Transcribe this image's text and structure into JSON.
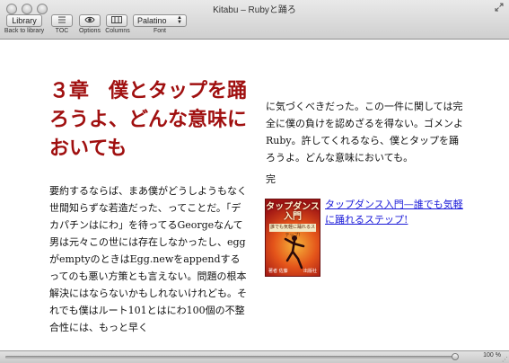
{
  "window": {
    "title": "Kitabu – Rubyと踊ろ"
  },
  "toolbar": {
    "library_button": "Library",
    "library_label": "Back to library",
    "toc_label": "TOC",
    "options_label": "Options",
    "columns_label": "Columns",
    "font_value": "Palatino",
    "font_label": "Font"
  },
  "chapter": {
    "title": "３章　僕とタップを踊ろうよ、どんな意味においても",
    "left_text": "要約するならば、まあ僕がどうしようもなく世間知らずな若造だった、ってことだ。「デカパチンはにわ」を待ってるGeorgeなんて男は元々この世には存在しなかったし、eggがemptyのときはEgg.newをappendするってのも悪い方策とも言えない。問題の根本解決にはならないかもしれないけれども。それでも僕はルート101とはにわ100個の不整合性には、もっと早く",
    "right_text": "に気づくべきだった。この一件に関しては完全に僕の負けを認めざるを得ない。ゴメンよRuby。許してくれるなら、僕とタップを踊ろうよ。どんな意味においても。",
    "end_mark": "完"
  },
  "book": {
    "cover_title": "タップダンス入門",
    "cover_subtitle": "誰でも気軽に踊れるステップ!",
    "cover_author": "著者 佐藤",
    "cover_publisher": "出版社",
    "link_text": "タップダンス入門—誰でも気軽に踊れるステップ!"
  },
  "status": {
    "progress_percent": 100,
    "progress_text": "100 %"
  }
}
